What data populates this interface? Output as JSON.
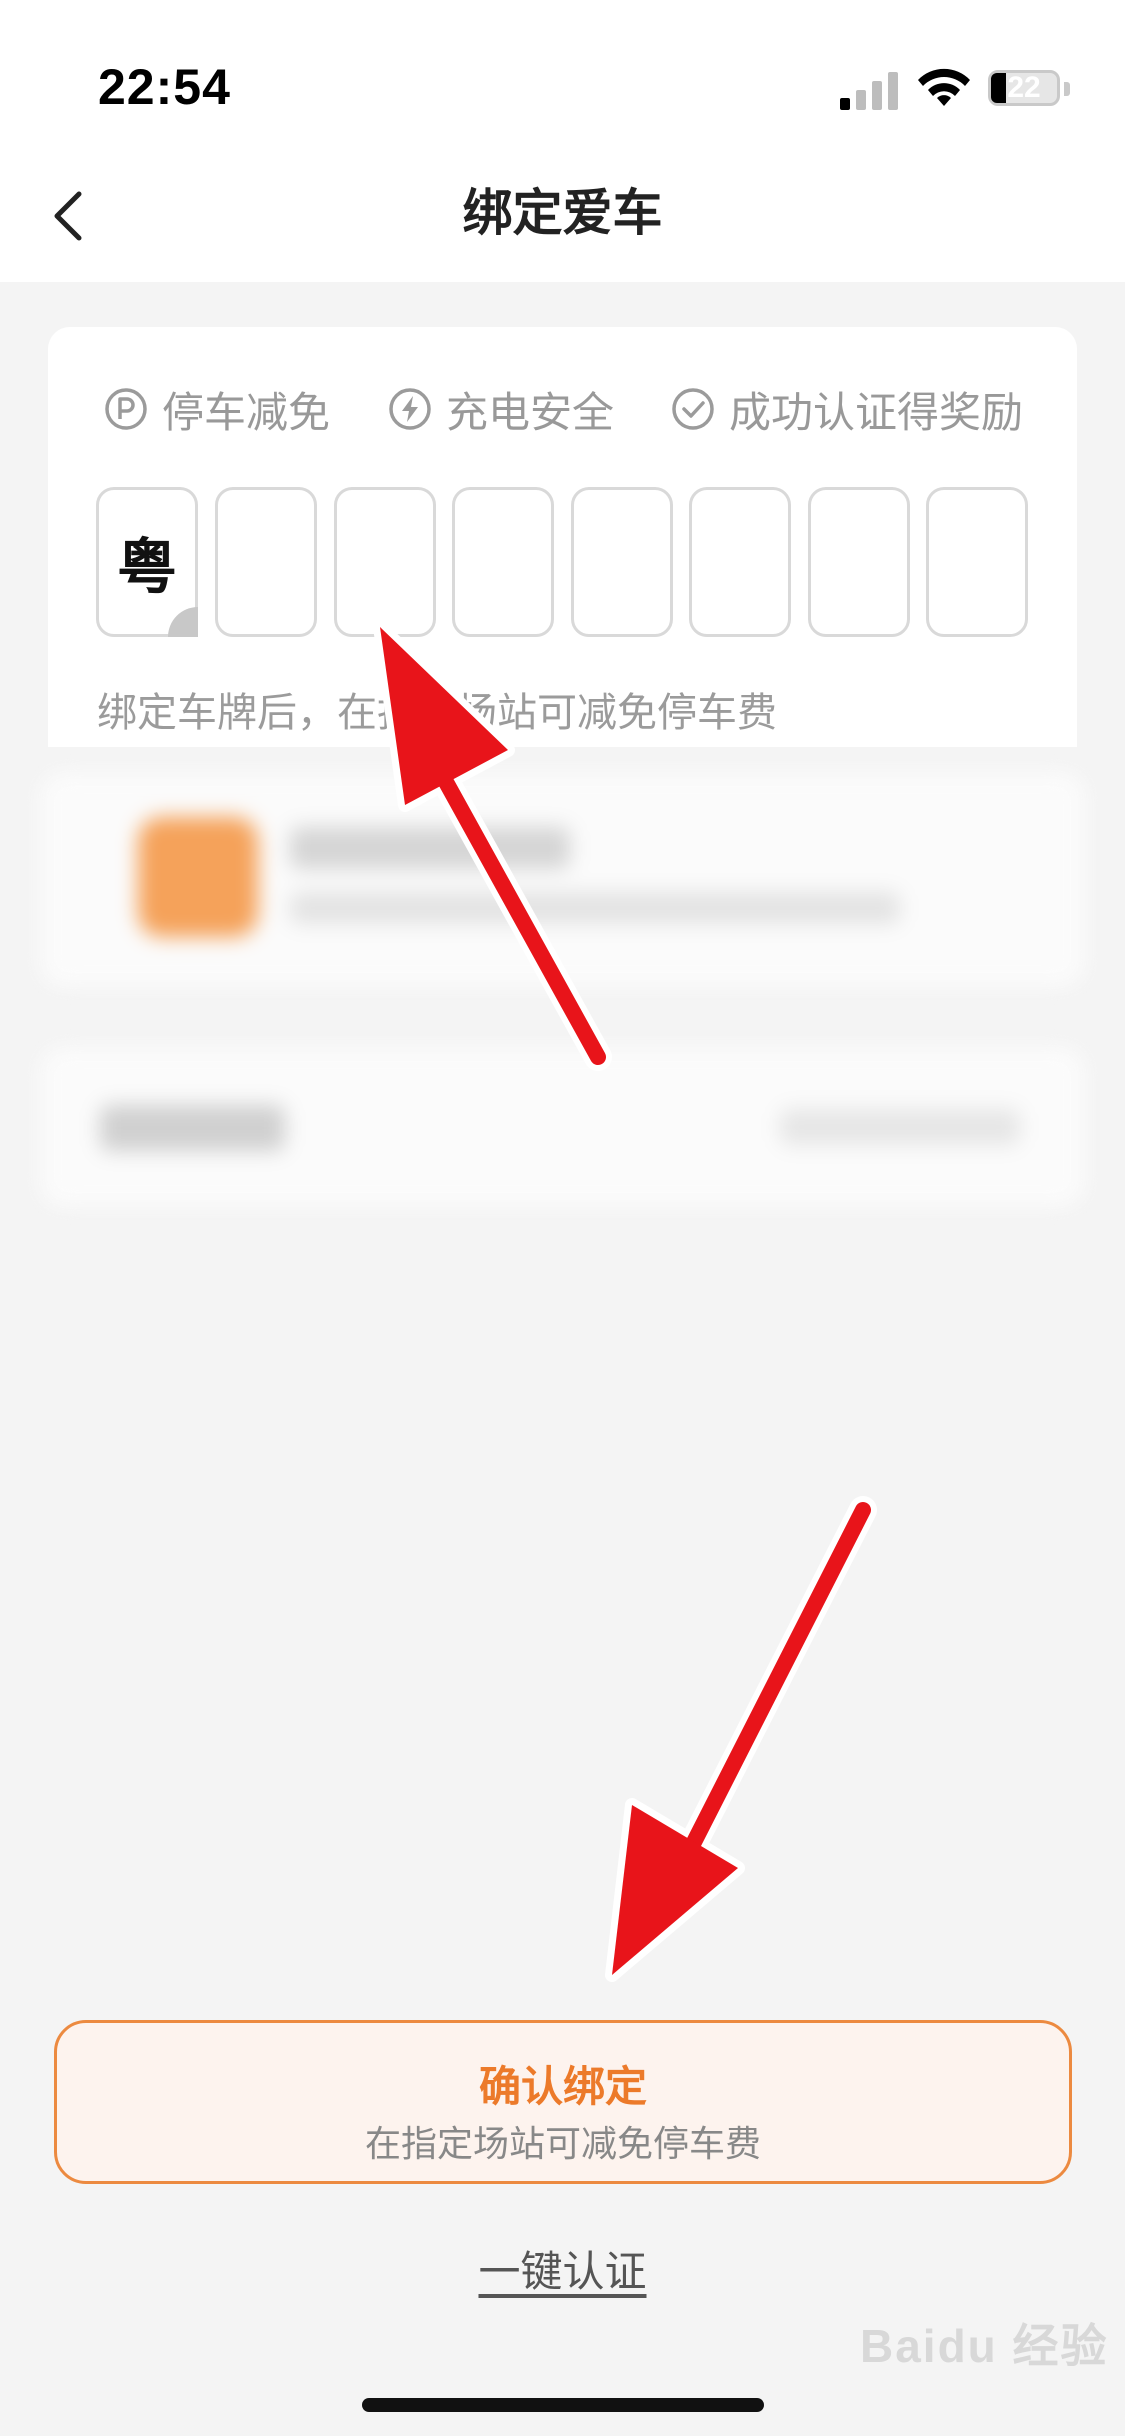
{
  "status_bar": {
    "time": "22:54",
    "battery": "22",
    "icons": [
      "signal-icon",
      "wifi-icon",
      "battery-icon"
    ]
  },
  "nav": {
    "title": "绑定爱车",
    "back_icon": "chevron-left-icon"
  },
  "benefits": [
    {
      "label": "停车减免",
      "icon": "parking-icon"
    },
    {
      "label": "充电安全",
      "icon": "lightning-icon"
    },
    {
      "label": "成功认证得奖励",
      "icon": "check-circle-icon"
    }
  ],
  "plate": {
    "prefix": "粤",
    "characters": [
      "",
      "",
      "",
      "",
      "",
      "",
      ""
    ]
  },
  "hint": "绑定车牌后，在指定场站可减免停车费",
  "confirm": {
    "label": "确认绑定",
    "subtitle": "在指定场站可减免停车费"
  },
  "one_click_link": "一键认证",
  "watermark": "Baidu 经验",
  "colors": {
    "accent": "#ec7a2a",
    "accent_bg": "#fdf3ee",
    "annotation_arrow": "#e8141a"
  }
}
